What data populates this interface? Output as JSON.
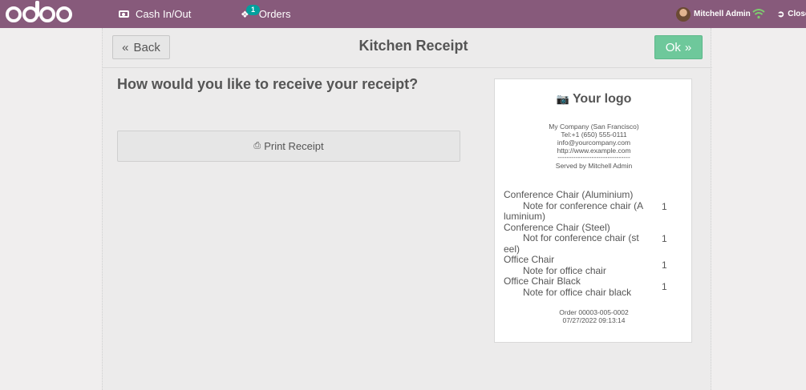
{
  "topbar": {
    "cash_label": "Cash In/Out",
    "orders_label": "Orders",
    "orders_badge": "1",
    "user_name": "Mitchell Admin",
    "close_label": "Close",
    "bar_color": "#875a7b",
    "badge_color": "#00a09d",
    "wifi_color": "#7ecb6f"
  },
  "header": {
    "back_label": "Back",
    "title": "Kitchen Receipt",
    "ok_label": "Ok",
    "ok_color": "#6ec89b"
  },
  "body": {
    "question": "How would you like to receive your receipt?",
    "print_label": "Print Receipt"
  },
  "receipt": {
    "logo_text": "Your logo",
    "company": "My Company (San Francisco)",
    "tel": "Tel:+1 (650) 555-0111",
    "email": "info@yourcompany.com",
    "website": "http://www.example.com",
    "separator": "--------------------------------",
    "served_by": "Served by Mitchell Admin",
    "lines": [
      {
        "name": "Conference Chair (Aluminium)",
        "note": "Note for conference chair (Aluminium)",
        "qty": "1"
      },
      {
        "name": "Conference Chair (Steel)",
        "note": "Not for conference chair (steel)",
        "qty": "1"
      },
      {
        "name": "Office Chair",
        "note": "Note for office chair",
        "qty": "1"
      },
      {
        "name": "Office Chair Black",
        "note": "Note for office chair black",
        "qty": "1"
      }
    ],
    "order_ref": "Order 00003-005-0002",
    "datetime": "07/27/2022 09:13:14"
  }
}
